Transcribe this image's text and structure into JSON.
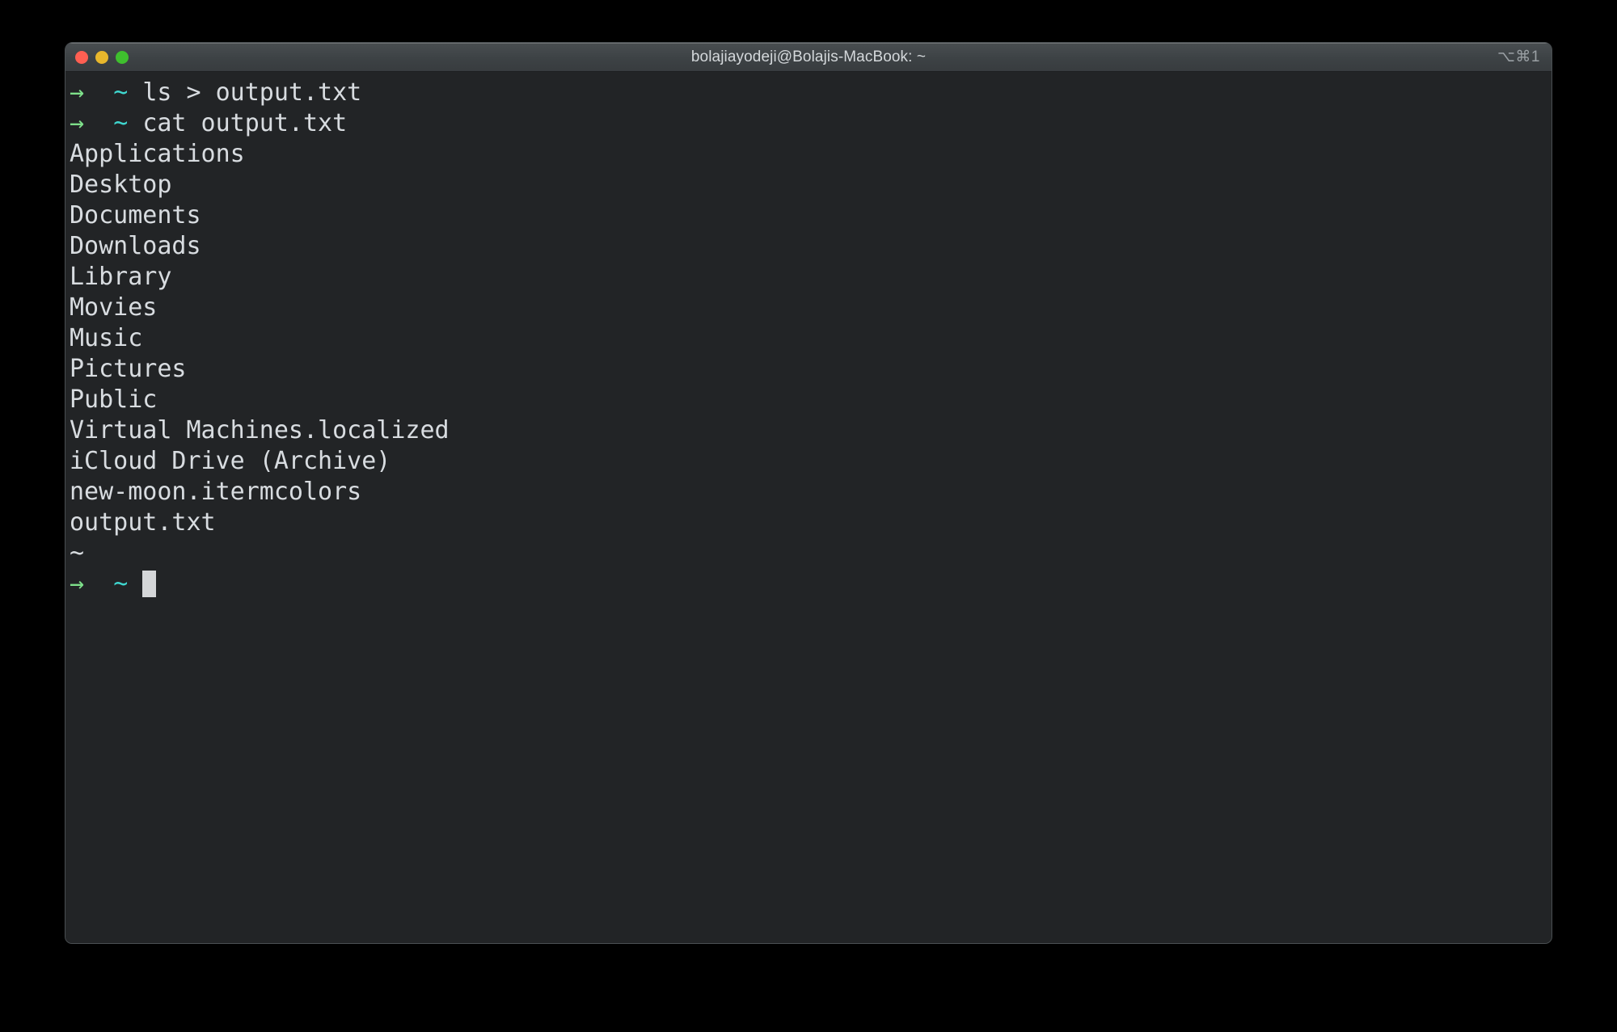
{
  "window": {
    "title": "bolajiayodeji@Bolajis-MacBook: ~",
    "shortcut_badge": "⌥⌘1",
    "traffic_lights": [
      {
        "name": "close",
        "color": "#ff5f52"
      },
      {
        "name": "minimize",
        "color": "#e8b72c"
      },
      {
        "name": "maximize",
        "color": "#3fbf2e"
      }
    ]
  },
  "theme": {
    "background": "#222426",
    "foreground": "#d8dce0",
    "prompt_arrow": "#7ee08a",
    "prompt_path": "#3fd7cf",
    "titlebar": "#3d4245",
    "cursor": "#d4d6d8",
    "desktop": "#000000"
  },
  "terminal": {
    "prompt": {
      "arrow": "→",
      "gap_after_arrow": "  ",
      "path": "~",
      "gap_after_path": " "
    },
    "lines": [
      {
        "type": "command",
        "command": "ls > output.txt"
      },
      {
        "type": "command",
        "command": "cat output.txt"
      },
      {
        "type": "output",
        "text": "Applications"
      },
      {
        "type": "output",
        "text": "Desktop"
      },
      {
        "type": "output",
        "text": "Documents"
      },
      {
        "type": "output",
        "text": "Downloads"
      },
      {
        "type": "output",
        "text": "Library"
      },
      {
        "type": "output",
        "text": "Movies"
      },
      {
        "type": "output",
        "text": "Music"
      },
      {
        "type": "output",
        "text": "Pictures"
      },
      {
        "type": "output",
        "text": "Public"
      },
      {
        "type": "output",
        "text": "Virtual Machines.localized"
      },
      {
        "type": "output",
        "text": "iCloud Drive (Archive)"
      },
      {
        "type": "output",
        "text": "new-moon.itermcolors"
      },
      {
        "type": "output",
        "text": "output.txt"
      },
      {
        "type": "output",
        "text": "~"
      },
      {
        "type": "prompt",
        "command": ""
      }
    ]
  }
}
